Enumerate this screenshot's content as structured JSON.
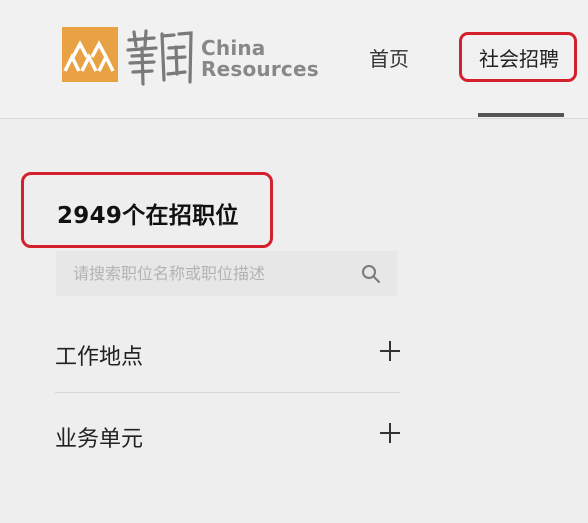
{
  "header": {
    "logo": {
      "chinese_text": "華潤",
      "english_line1": "China",
      "english_line2": "Resources",
      "brand_color": "#e9a243"
    },
    "nav": {
      "home_label": "首页",
      "jobs_label": "社会招聘",
      "active": "jobs"
    }
  },
  "main": {
    "job_count_text": "2949个在招职位",
    "search": {
      "placeholder": "请搜索职位名称或职位描述",
      "value": ""
    },
    "filters": [
      {
        "label": "工作地点",
        "icon": "plus-icon"
      },
      {
        "label": "业务单元",
        "icon": "plus-icon"
      }
    ]
  },
  "annotations": {
    "highlight_color": "#d4202c"
  }
}
